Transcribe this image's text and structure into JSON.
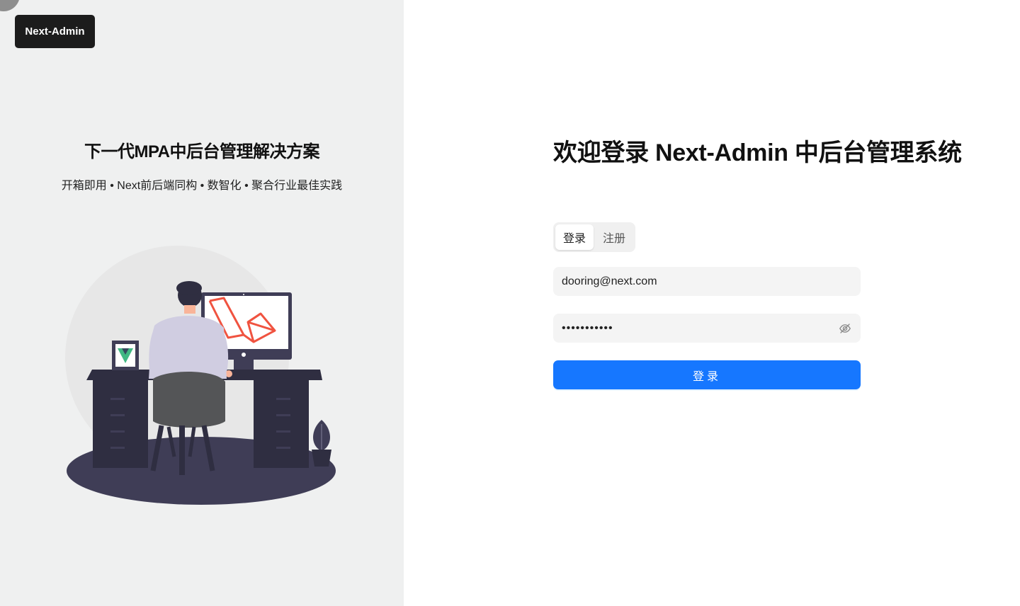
{
  "brand": {
    "logo_label": "Next-Admin"
  },
  "hero": {
    "tagline": "下一代MPA中后台管理解决方案",
    "features": "开箱即用 • Next前后端同构 • 数智化 • 聚合行业最佳实践"
  },
  "login": {
    "welcome_title": "欢迎登录 Next-Admin 中后台管理系统",
    "tabs": [
      {
        "label": "登录",
        "active": true
      },
      {
        "label": "注册",
        "active": false
      }
    ],
    "email_value": "dooring@next.com",
    "password_value": "12345678901",
    "submit_label": "登录",
    "password_toggle_icon": "eye-invisible-icon"
  },
  "colors": {
    "primary": "#1677ff",
    "left_panel_bg": "#eff0f0",
    "logo_bg": "#1c1c1c",
    "input_bg": "#f4f4f4"
  }
}
